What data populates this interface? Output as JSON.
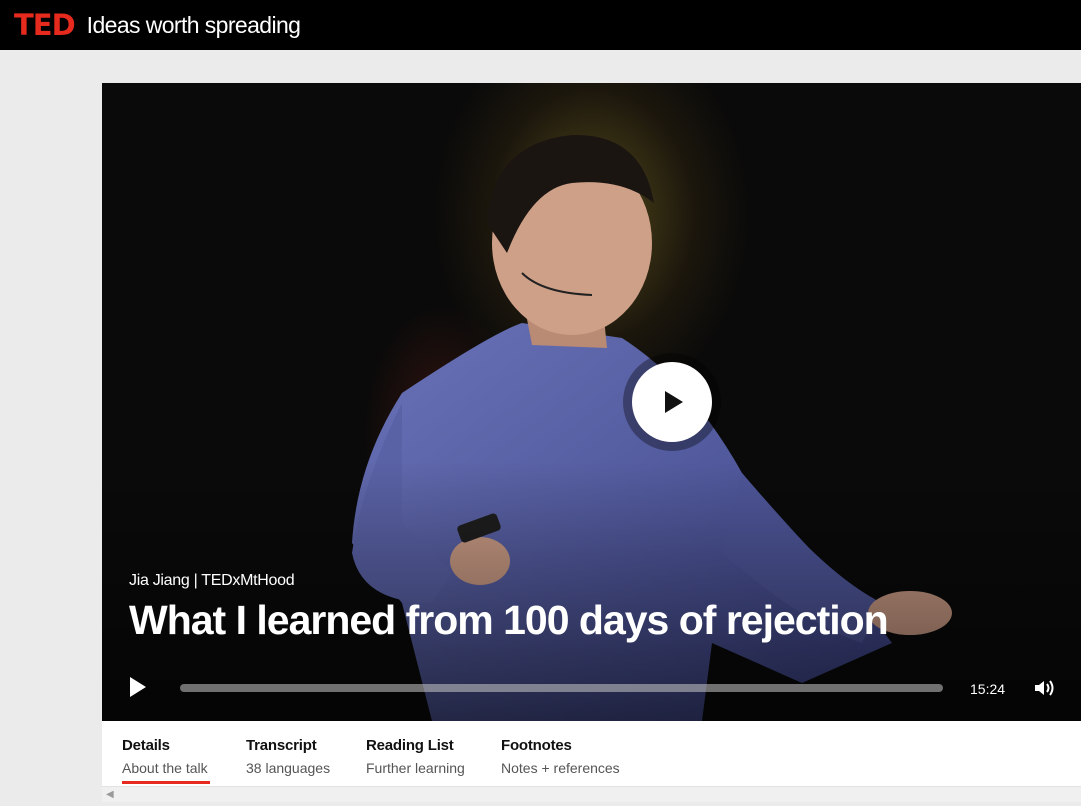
{
  "header": {
    "logo": "TED",
    "tagline": "Ideas worth spreading"
  },
  "player": {
    "speaker_event": "Jia Jiang | TEDxMtHood",
    "title": "What I learned from 100 days of rejection",
    "duration": "15:24",
    "progress": 0,
    "icons": {
      "big_play": "play-icon",
      "small_play": "play-icon",
      "volume": "volume-icon"
    }
  },
  "tabs": [
    {
      "label": "Details",
      "sub": "About the talk"
    },
    {
      "label": "Transcript",
      "sub": "38 languages"
    },
    {
      "label": "Reading List",
      "sub": "Further learning"
    },
    {
      "label": "Footnotes",
      "sub": "Notes + references"
    }
  ],
  "colors": {
    "brand_red": "#e62b1e",
    "header_bg": "#000000",
    "page_bg": "#ebebeb"
  }
}
